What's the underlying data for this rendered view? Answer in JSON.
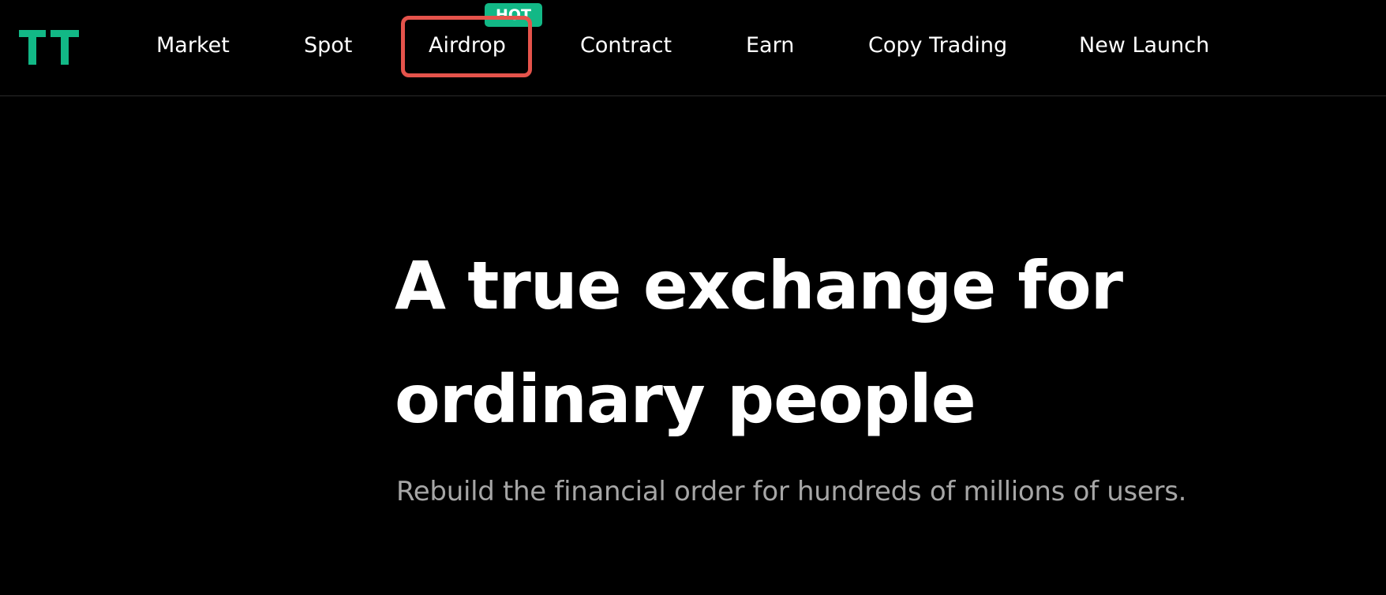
{
  "header": {
    "logo_icon": "tt-logo-icon",
    "logo_color": "#12b886",
    "nav": {
      "market": "Market",
      "spot": "Spot",
      "airdrop": "Airdrop",
      "contract": "Contract",
      "earn": "Earn",
      "copy_trading": "Copy Trading",
      "new_launch": "New Launch"
    },
    "airdrop_badge": "HOT",
    "badge_color": "#12b886",
    "highlight_color": "#e5534b"
  },
  "hero": {
    "title_line1": "A true exchange for",
    "title_line2": "ordinary people",
    "subtitle": "Rebuild the financial order for hundreds of millions of users."
  }
}
